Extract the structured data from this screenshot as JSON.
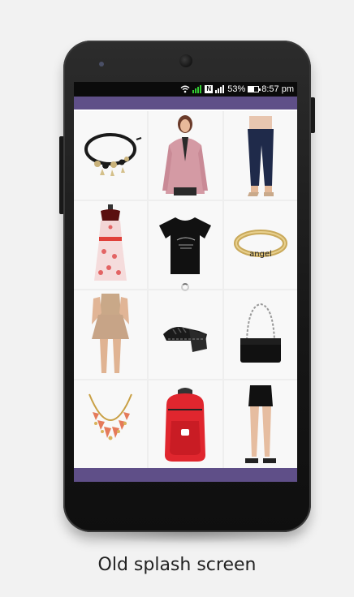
{
  "status_bar": {
    "battery_percent": "53%",
    "time": "8:57 pm",
    "network_badge": "N",
    "icons": [
      "wifi-icon",
      "signal-icon",
      "network-badge-icon",
      "signal-icon",
      "battery-icon"
    ]
  },
  "colors": {
    "accent_bar": "#5f4f88",
    "status_bar": "#0b0b0b",
    "page_background": "#f2f2f2"
  },
  "product_grid": {
    "items": [
      {
        "icon": "bracelet-icon"
      },
      {
        "icon": "blazer-woman-icon"
      },
      {
        "icon": "jeans-icon"
      },
      {
        "icon": "dress-mannequin-icon"
      },
      {
        "icon": "tshirt-icon"
      },
      {
        "icon": "ring-icon",
        "engraving": "angel"
      },
      {
        "icon": "skirt-icon"
      },
      {
        "icon": "wedge-shoe-icon"
      },
      {
        "icon": "handbag-icon"
      },
      {
        "icon": "necklace-icon"
      },
      {
        "icon": "backpack-icon"
      },
      {
        "icon": "mini-skirt-icon"
      }
    ]
  },
  "loading": {
    "icon": "spinner-icon"
  },
  "caption": "Old splash screen"
}
